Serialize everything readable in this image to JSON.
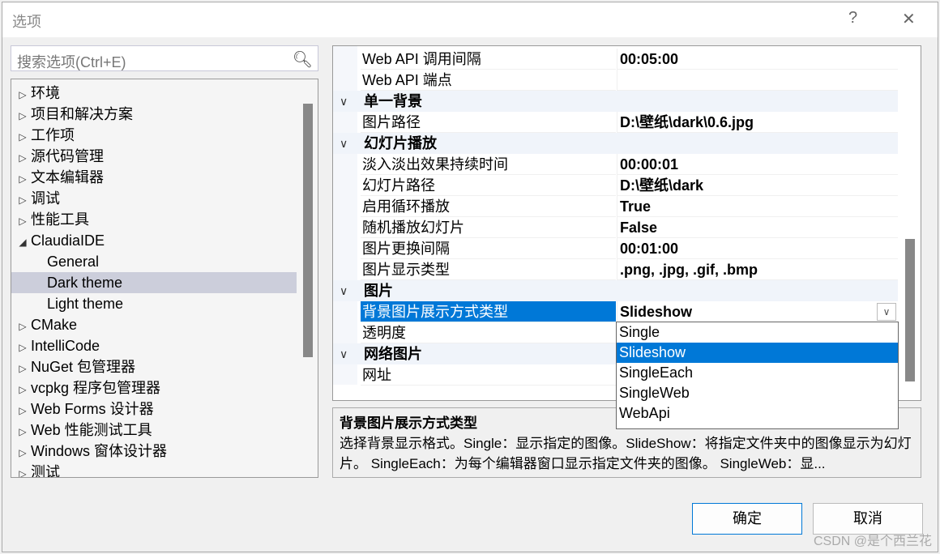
{
  "window": {
    "title": "选项",
    "help": "?",
    "close": "✕"
  },
  "search": {
    "placeholder": "搜索选项(Ctrl+E)",
    "icon": "search-icon"
  },
  "tree": [
    {
      "label": "环境",
      "expander": "▷",
      "indent": 0
    },
    {
      "label": "项目和解决方案",
      "expander": "▷",
      "indent": 0
    },
    {
      "label": "工作项",
      "expander": "▷",
      "indent": 0
    },
    {
      "label": "源代码管理",
      "expander": "▷",
      "indent": 0
    },
    {
      "label": "文本编辑器",
      "expander": "▷",
      "indent": 0
    },
    {
      "label": "调试",
      "expander": "▷",
      "indent": 0
    },
    {
      "label": "性能工具",
      "expander": "▷",
      "indent": 0
    },
    {
      "label": "ClaudiaIDE",
      "expander": "◢",
      "indent": 0
    },
    {
      "label": "General",
      "expander": "",
      "indent": 1
    },
    {
      "label": "Dark theme",
      "expander": "",
      "indent": 1,
      "selected": true
    },
    {
      "label": "Light theme",
      "expander": "",
      "indent": 1
    },
    {
      "label": "CMake",
      "expander": "▷",
      "indent": 0
    },
    {
      "label": "IntelliCode",
      "expander": "▷",
      "indent": 0
    },
    {
      "label": "NuGet 包管理器",
      "expander": "▷",
      "indent": 0
    },
    {
      "label": "vcpkg 程序包管理器",
      "expander": "▷",
      "indent": 0
    },
    {
      "label": "Web Forms 设计器",
      "expander": "▷",
      "indent": 0
    },
    {
      "label": "Web 性能测试工具",
      "expander": "▷",
      "indent": 0
    },
    {
      "label": "Windows 窗体设计器",
      "expander": "▷",
      "indent": 0
    },
    {
      "label": "测试",
      "expander": "▷",
      "indent": 0
    }
  ],
  "grid": [
    {
      "name": "Web API 调用间隔",
      "value": "00:05:00"
    },
    {
      "name": "Web API 端点",
      "value": ""
    },
    {
      "category": true,
      "name": "单一背景"
    },
    {
      "name": "图片路径",
      "value": "D:\\壁纸\\dark\\0.6.jpg"
    },
    {
      "category": true,
      "name": "幻灯片播放"
    },
    {
      "name": "淡入淡出效果持续时间",
      "value": "00:00:01"
    },
    {
      "name": "幻灯片路径",
      "value": "D:\\壁纸\\dark"
    },
    {
      "name": "启用循环播放",
      "value": "True"
    },
    {
      "name": "随机播放幻灯片",
      "value": "False"
    },
    {
      "name": "图片更换间隔",
      "value": "00:01:00"
    },
    {
      "name": "图片显示类型",
      "value": ".png, .jpg, .gif, .bmp"
    },
    {
      "category": true,
      "name": "图片"
    },
    {
      "name": "背景图片展示方式类型",
      "value": "Slideshow",
      "selected": true,
      "dropdown": true
    },
    {
      "name": "透明度",
      "value": ""
    },
    {
      "category": true,
      "name": "网络图片"
    },
    {
      "name": "网址",
      "value": ""
    }
  ],
  "dropdown": {
    "options": [
      "Single",
      "Slideshow",
      "SingleEach",
      "SingleWeb",
      "WebApi"
    ],
    "selected": "Slideshow"
  },
  "description": {
    "title": "背景图片展示方式类型",
    "text": "选择背景显示格式。Single：显示指定的图像。SlideShow：将指定文件夹中的图像显示为幻灯片。 SingleEach：为每个编辑器窗口显示指定文件夹的图像。 SingleWeb：显..."
  },
  "buttons": {
    "ok": "确定",
    "cancel": "取消"
  },
  "watermark": "CSDN @是个西兰花",
  "colors": {
    "accent": "#0078d7",
    "tree_selected": "#cccedb"
  }
}
